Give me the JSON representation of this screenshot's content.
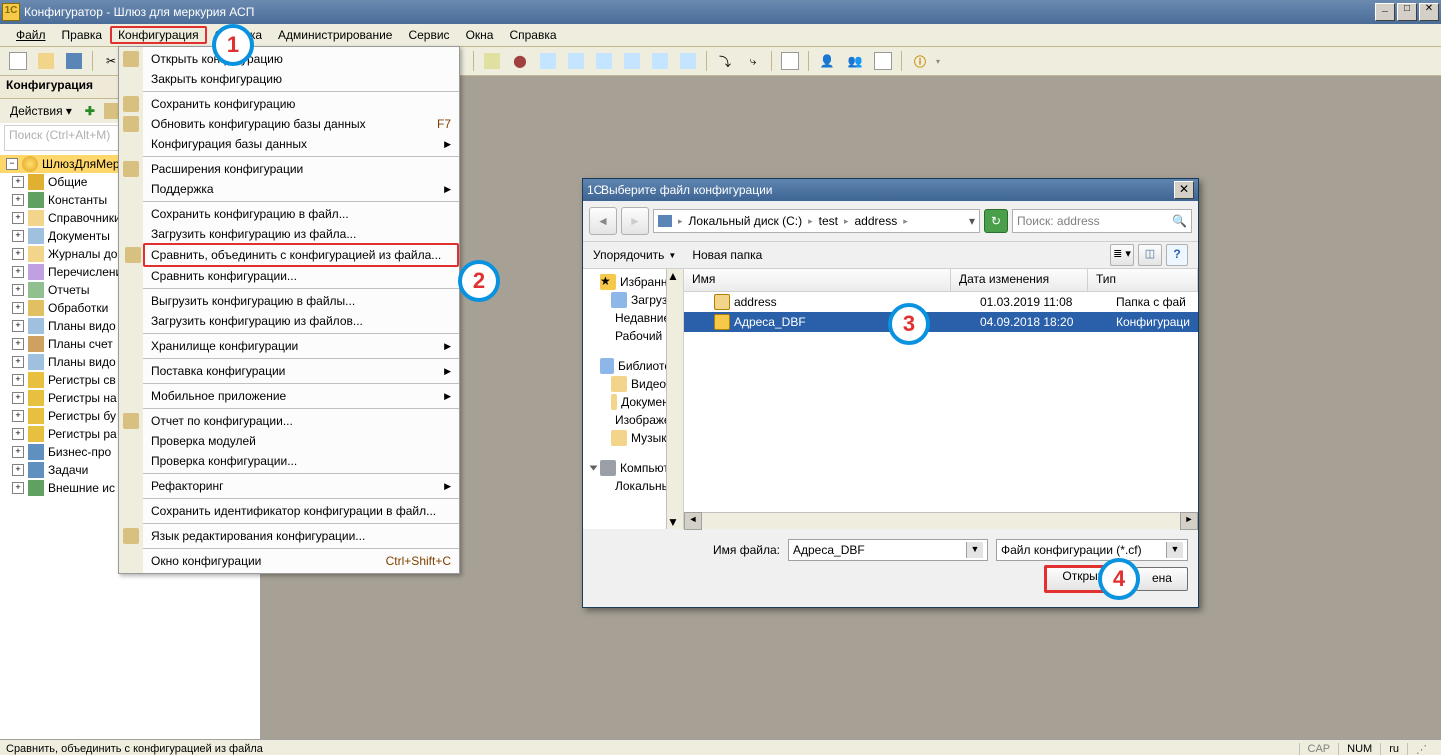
{
  "title": "Конфигуратор - Шлюз для меркурия АСП",
  "menubar": [
    "Файл",
    "Правка",
    "Конфигурация",
    "Отладка",
    "Администрирование",
    "Сервис",
    "Окна",
    "Справка"
  ],
  "configPanel": {
    "title": "Конфигурация",
    "actions": "Действия ▾",
    "searchPlaceholder": "Поиск (Ctrl+Alt+M)",
    "root": "ШлюзДляМерку",
    "items": [
      "Общие",
      "Константы",
      "Справочники",
      "Документы",
      "Журналы до",
      "Перечислени",
      "Отчеты",
      "Обработки",
      "Планы видо",
      "Планы счет",
      "Планы видо",
      "Регистры св",
      "Регистры на",
      "Регистры бу",
      "Регистры ра",
      "Бизнес-про",
      "Задачи",
      "Внешние ис"
    ]
  },
  "dropdown": {
    "items": [
      {
        "label": "Открыть конфигурацию",
        "icon": true
      },
      {
        "label": "Закрыть конфигурацию",
        "icon": false
      },
      {
        "sep": true
      },
      {
        "label": "Сохранить конфигурацию",
        "icon": true
      },
      {
        "label": "Обновить конфигурацию базы данных",
        "icon": true,
        "shortcut": "F7"
      },
      {
        "label": "Конфигурация базы данных",
        "icon": false,
        "sub": true
      },
      {
        "sep": true
      },
      {
        "label": "Расширения конфигурации",
        "icon": true
      },
      {
        "label": "Поддержка",
        "icon": false,
        "sub": true
      },
      {
        "sep": true
      },
      {
        "label": "Сохранить конфигурацию в файл...",
        "icon": false
      },
      {
        "label": "Загрузить конфигурацию из файла...",
        "icon": false
      },
      {
        "label": "Сравнить, объединить с конфигурацией из файла...",
        "icon": true,
        "sel": true
      },
      {
        "label": "Сравнить конфигурации...",
        "icon": false
      },
      {
        "sep": true
      },
      {
        "label": "Выгрузить конфигурацию в файлы...",
        "icon": false
      },
      {
        "label": "Загрузить конфигурацию из файлов...",
        "icon": false
      },
      {
        "sep": true
      },
      {
        "label": "Хранилище конфигурации",
        "icon": false,
        "sub": true
      },
      {
        "sep": true
      },
      {
        "label": "Поставка конфигурации",
        "icon": false,
        "sub": true
      },
      {
        "sep": true
      },
      {
        "label": "Мобильное приложение",
        "icon": false,
        "sub": true
      },
      {
        "sep": true
      },
      {
        "label": "Отчет по конфигурации...",
        "icon": true
      },
      {
        "label": "Проверка модулей",
        "icon": false
      },
      {
        "label": "Проверка конфигурации...",
        "icon": false
      },
      {
        "sep": true
      },
      {
        "label": "Рефакторинг",
        "icon": false,
        "sub": true
      },
      {
        "sep": true
      },
      {
        "label": "Сохранить идентификатор конфигурации в файл...",
        "icon": false
      },
      {
        "sep": true
      },
      {
        "label": "Язык редактирования конфигурации...",
        "icon": true
      },
      {
        "sep": true
      },
      {
        "label": "Окно конфигурации",
        "icon": false,
        "shortcut": "Ctrl+Shift+C"
      }
    ]
  },
  "dialog": {
    "title": "Выберите файл конфигурации",
    "breadcrumb": [
      "Локальный диск (C:)",
      "test",
      "address"
    ],
    "searchPlaceholder": "Поиск: address",
    "tool_arrange": "Упорядочить",
    "tool_newfolder": "Новая папка",
    "cols": {
      "name": "Имя",
      "date": "Дата изменения",
      "type": "Тип"
    },
    "rows": [
      {
        "name": "address",
        "date": "01.03.2019 11:08",
        "type": "Папка с фай",
        "kind": "folder"
      },
      {
        "name": "Адреса_DBF",
        "date": "04.09.2018 18:20",
        "type": "Конфигураци",
        "kind": "cf",
        "sel": true
      }
    ],
    "nav": {
      "fav": "Избранное",
      "fav_items": [
        "Загрузки",
        "Недавние места",
        "Рабочий стол"
      ],
      "lib": "Библиотеки",
      "lib_items": [
        "Видео",
        "Документы",
        "Изображения",
        "Музыка"
      ],
      "pc": "Компьютер",
      "pc_items": [
        "Локальный диск ("
      ]
    },
    "filename_label": "Имя файла:",
    "filename_value": "Адреса_DBF",
    "filter": "Файл конфигурации (*.cf)",
    "btn_open": "Открыть",
    "btn_cancel": "ена"
  },
  "callouts": {
    "1": "1",
    "2": "2",
    "3": "3",
    "4": "4"
  },
  "status": {
    "text": "Сравнить, объединить с конфигурацией из файла",
    "cap": "CAP",
    "num": "NUM",
    "lang": "ru"
  }
}
